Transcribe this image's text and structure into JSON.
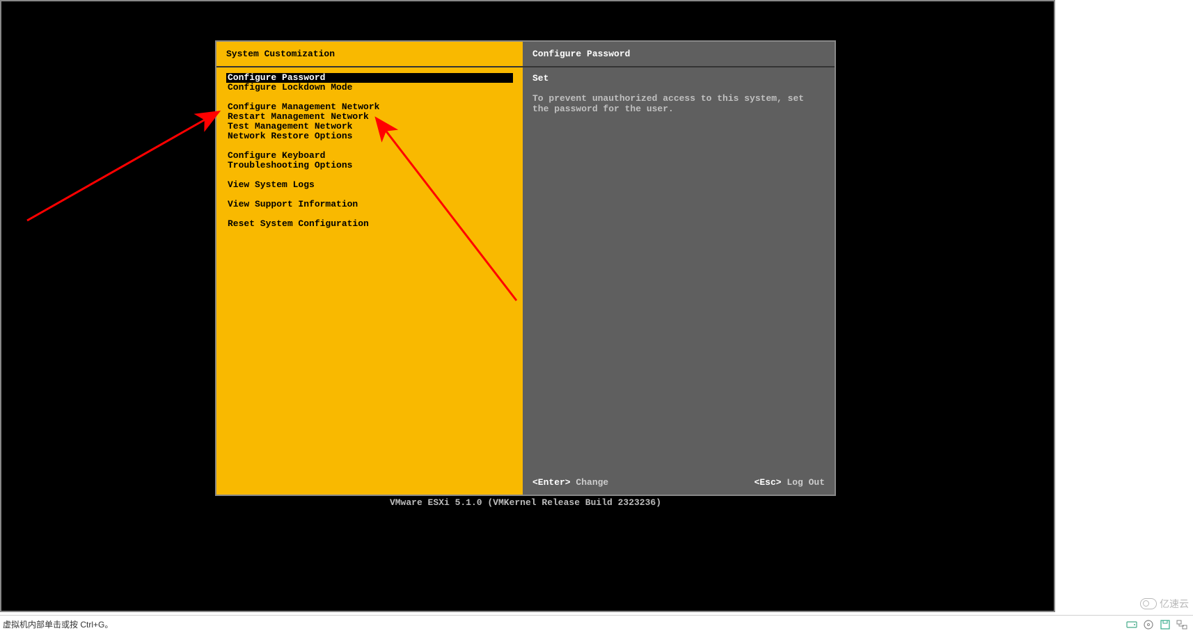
{
  "left": {
    "title": "System Customization",
    "groups": [
      [
        {
          "label": "Configure Password",
          "selected": true
        },
        {
          "label": "Configure Lockdown Mode"
        }
      ],
      [
        {
          "label": "Configure Management Network"
        },
        {
          "label": "Restart Management Network"
        },
        {
          "label": "Test Management Network"
        },
        {
          "label": "Network Restore Options"
        }
      ],
      [
        {
          "label": "Configure Keyboard"
        },
        {
          "label": "Troubleshooting Options"
        }
      ],
      [
        {
          "label": "View System Logs"
        }
      ],
      [
        {
          "label": "View Support Information"
        }
      ],
      [
        {
          "label": "Reset System Configuration"
        }
      ]
    ]
  },
  "right": {
    "title": "Configure Password",
    "status": "Set",
    "description": "To prevent unauthorized access to this system, set the password for the user."
  },
  "footer": {
    "enter_key": "<Enter>",
    "enter_label": "Change",
    "esc_key": "<Esc>",
    "esc_label": "Log Out"
  },
  "version": "VMware ESXi 5.1.0 (VMKernel Release Build 2323236)",
  "host_status": "虚拟机内部单击或按 Ctrl+G。",
  "watermark": "亿速云"
}
